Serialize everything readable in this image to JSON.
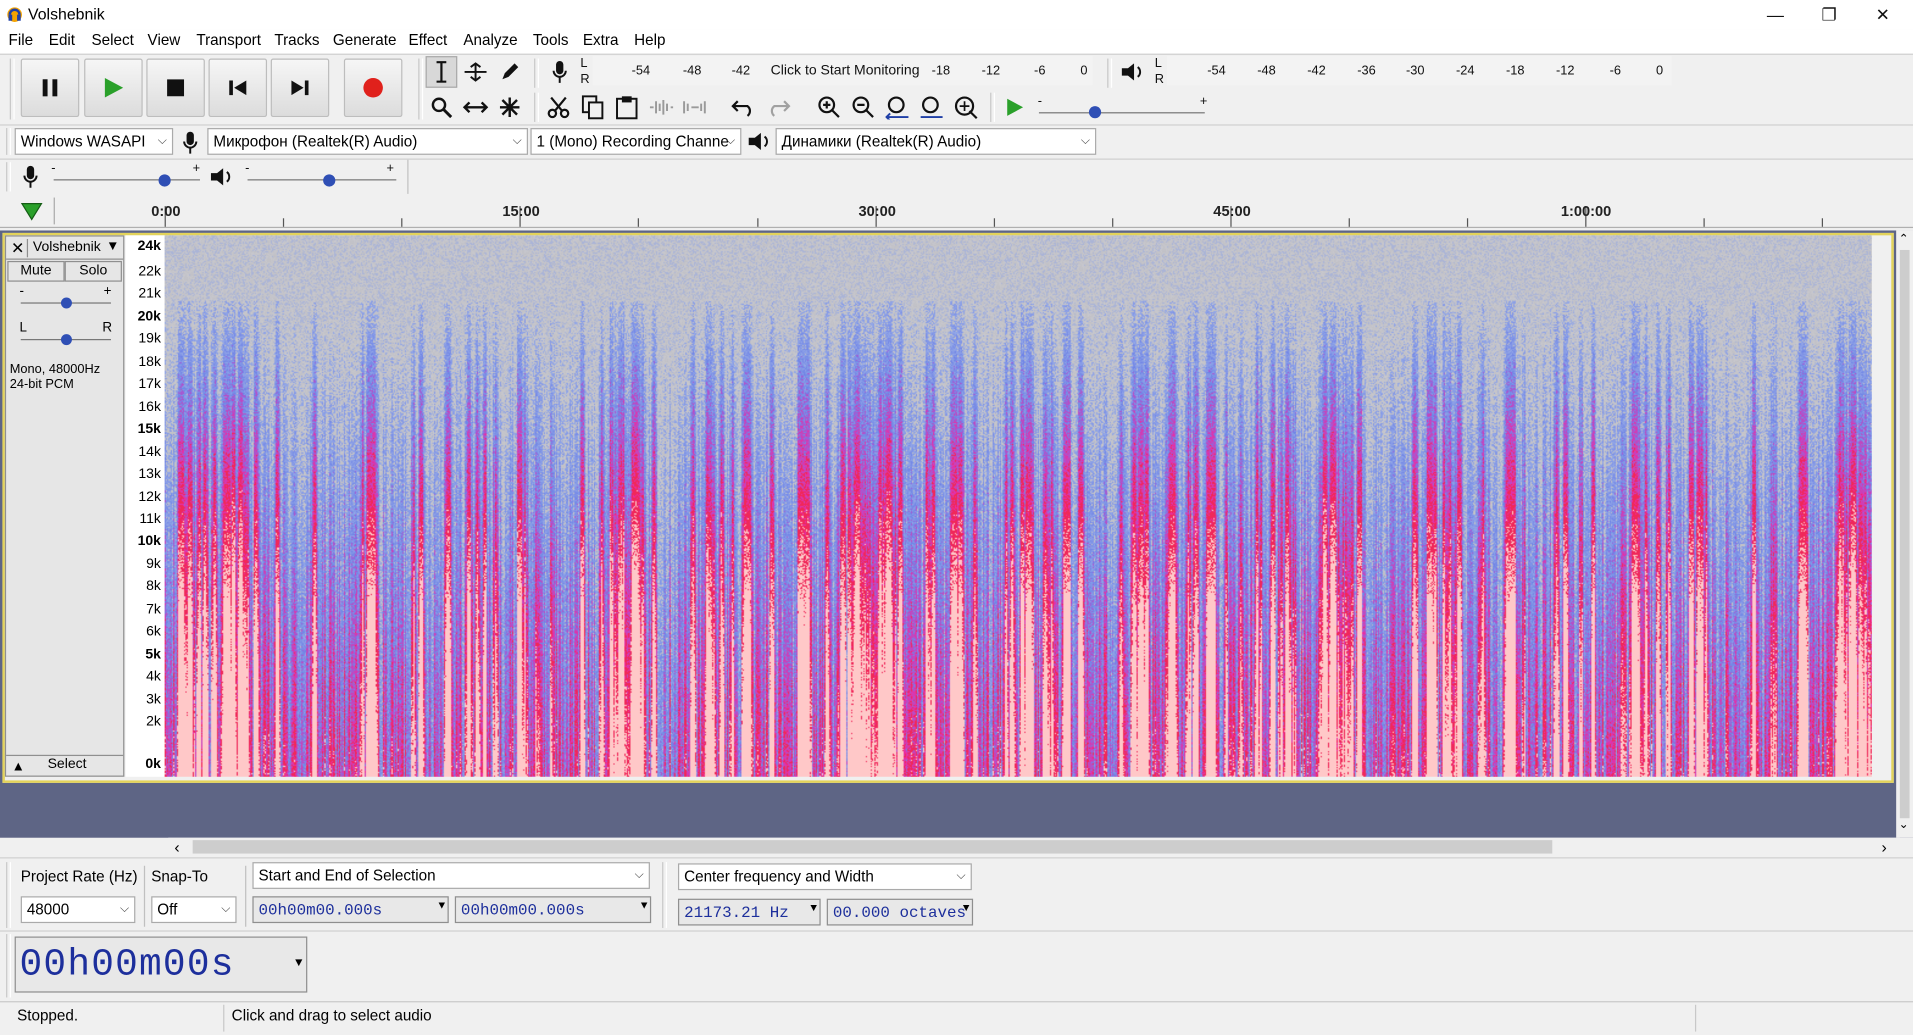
{
  "window": {
    "title": "Volshebnik"
  },
  "menu": [
    "File",
    "Edit",
    "Select",
    "View",
    "Transport",
    "Tracks",
    "Generate",
    "Effect",
    "Analyze",
    "Tools",
    "Extra",
    "Help"
  ],
  "meters": {
    "record_channels": [
      "L",
      "R"
    ],
    "record_scale": [
      "-54",
      "-48",
      "-42",
      "-18",
      "-12",
      "-6",
      "0"
    ],
    "monitor_text": "Click to Start Monitoring",
    "play_scale": [
      "-54",
      "-48",
      "-42",
      "-36",
      "-30",
      "-24",
      "-18",
      "-12",
      "-6",
      "0"
    ],
    "play_channels": [
      "L",
      "R"
    ]
  },
  "device": {
    "host": "Windows WASAPI",
    "recording_device": "Микрофон (Realtek(R) Audio)",
    "channels": "1 (Mono) Recording Channe",
    "playback_device": "Динамики (Realtek(R) Audio)"
  },
  "mixer": {
    "minus": "-",
    "plus": "+"
  },
  "play_speed": {
    "minus": "-",
    "plus": "+"
  },
  "ruler": {
    "labels": [
      "0:00",
      "15:00",
      "30:00",
      "45:00",
      "1:00:00"
    ]
  },
  "track": {
    "name": "Volshebnik",
    "mute_label": "Mute",
    "solo_label": "Solo",
    "gain_minus": "-",
    "gain_plus": "+",
    "pan_left": "L",
    "pan_right": "R",
    "info_line1": "Mono, 48000Hz",
    "info_line2": "24-bit PCM",
    "select_label": "Select",
    "freq_labels": [
      "24k",
      "22k",
      "21k",
      "20k",
      "19k",
      "18k",
      "17k",
      "16k",
      "15k",
      "14k",
      "13k",
      "12k",
      "11k",
      "10k",
      "9k",
      "8k",
      "7k",
      "6k",
      "5k",
      "4k",
      "3k",
      "2k",
      "0k"
    ]
  },
  "selection_toolbar": {
    "rate_label": "Project Rate (Hz)",
    "rate_value": "48000",
    "snap_label": "Snap-To",
    "snap_value": "Off",
    "mode": "Start and End of Selection",
    "start": "00h00m00.000s",
    "end": "00h00m00.000s"
  },
  "spectral_toolbar": {
    "mode": "Center frequency and Width",
    "center": "21173.21 Hz",
    "width": "00.000 octaves"
  },
  "time_display": "00h00m00s",
  "status": {
    "state": "Stopped.",
    "hint": "Click and drag to select audio"
  },
  "colors": {
    "accent_record": "#e0211c",
    "play_green": "#2aa02a",
    "track_bg": "#5e6585",
    "frame_yellow": "#e3d35a"
  }
}
